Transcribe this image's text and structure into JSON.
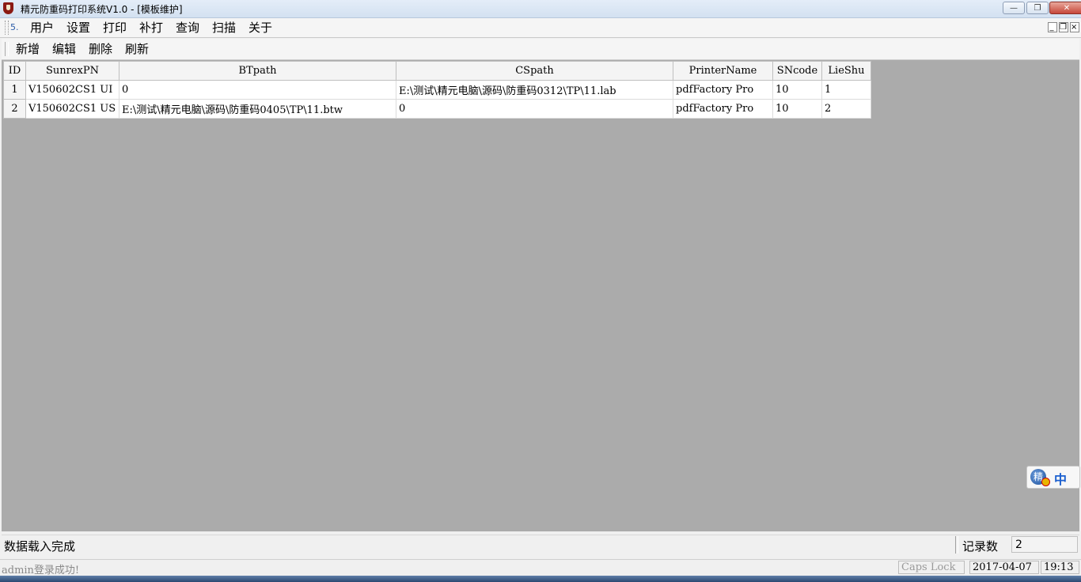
{
  "window": {
    "title": "精元防重码打印系统V1.0 - [模板维护]",
    "controls": {
      "minimize": "—",
      "maximize": "❐",
      "close": "✕"
    }
  },
  "menubar": {
    "items": [
      "用户",
      "设置",
      "打印",
      "补打",
      "查询",
      "扫描",
      "关于"
    ],
    "mdi_controls": {
      "minimize": "_",
      "restore": "❐",
      "close": "×"
    }
  },
  "toolbar": {
    "buttons": [
      "新增",
      "编辑",
      "删除",
      "刷新"
    ]
  },
  "grid": {
    "columns": [
      "ID",
      "SunrexPN",
      "BTpath",
      "CSpath",
      "PrinterName",
      "SNcode",
      "LieShu"
    ],
    "rows": [
      [
        "1",
        "V150602CS1 UI",
        "0",
        "E:\\测试\\精元电脑\\源码\\防重码0312\\TP\\11.lab",
        "pdfFactory Pro",
        "10",
        "1"
      ],
      [
        "2",
        "V150602CS1 US",
        "E:\\测试\\精元电脑\\源码\\防重码0405\\TP\\11.btw",
        "0",
        "pdfFactory Pro",
        "10",
        "2"
      ]
    ]
  },
  "ime": {
    "mode": "中",
    "icon": "ime-ball-icon"
  },
  "status": {
    "message": "数据载入完成",
    "record_label": "记录数",
    "record_count": "2"
  },
  "bottom_status": {
    "login_message": "admin登录成功!",
    "caps_lock": "Caps Lock",
    "date": "2017-04-07",
    "time": "19:13"
  }
}
